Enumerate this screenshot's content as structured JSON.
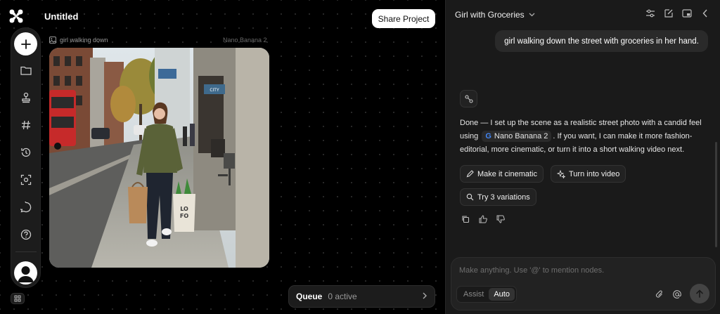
{
  "app": {
    "project_title": "Untitled",
    "share_label": "Share Project"
  },
  "toolbar": {
    "items": [
      "add-icon",
      "folder-icon",
      "stamp-icon",
      "hash-icon",
      "history-icon",
      "scan-icon",
      "chat-icon",
      "help-icon"
    ]
  },
  "node": {
    "label": "girl walking down",
    "model": "Nano Banana 2"
  },
  "queue": {
    "label": "Queue",
    "status": "0 active"
  },
  "panel": {
    "title": "Girl with Groceries",
    "user_message": "girl walking down the street with groceries in her hand.",
    "reply_part1": "Done — I set up the scene as a realistic street photo with a candid feel using",
    "model_chip": "Nano Banana 2",
    "reply_part2": ". If you want, I can make it more fashion-editorial, more cinematic, or turn it into a short walking video next.",
    "suggestions": {
      "cinematic": "Make it cinematic",
      "video": "Turn into video",
      "variations": "Try 3 variations"
    }
  },
  "composer": {
    "placeholder": "Make anything. Use '@' to mention nodes.",
    "mode_assist": "Assist",
    "mode_auto": "Auto",
    "active_mode": "Auto"
  },
  "colors": {
    "background": "#000000",
    "panel": "#1a1a1a",
    "accent": "#ffffff"
  }
}
